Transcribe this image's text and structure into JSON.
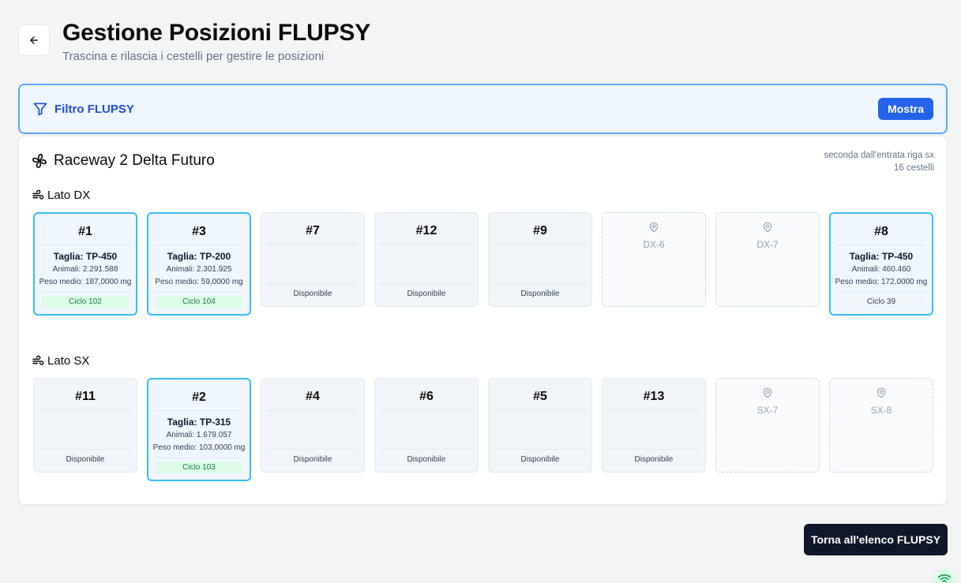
{
  "header": {
    "title": "Gestione Posizioni FLUPSY",
    "subtitle": "Trascina e rilascia i cestelli per gestire le posizioni"
  },
  "filter": {
    "label": "Filtro FLUPSY",
    "button_label": "Mostra"
  },
  "raceway": {
    "name": "Raceway 2 Delta Futuro",
    "location": "seconda dall'entrata riga sx",
    "count": "16 cestelli",
    "sides": [
      {
        "label": "Lato DX",
        "slots": [
          {
            "type": "active",
            "number": "#1",
            "taglia": "Taglia: TP-450",
            "animali": "Animali: 2.291.588",
            "peso": "Peso medio: 187,0000 mg",
            "ciclo": "Ciclo 102",
            "ciclo_style": "green"
          },
          {
            "type": "active",
            "number": "#3",
            "taglia": "Taglia: TP-200",
            "animali": "Animali: 2.301.925",
            "peso": "Peso medio: 59,0000 mg",
            "ciclo": "Ciclo 104",
            "ciclo_style": "green"
          },
          {
            "type": "available",
            "number": "#7",
            "status": "Disponibile"
          },
          {
            "type": "available",
            "number": "#12",
            "status": "Disponibile"
          },
          {
            "type": "available",
            "number": "#9",
            "status": "Disponibile"
          },
          {
            "type": "empty",
            "position": "DX-6"
          },
          {
            "type": "empty",
            "position": "DX-7"
          },
          {
            "type": "active",
            "number": "#8",
            "taglia": "Taglia: TP-450",
            "animali": "Animali: 460.460",
            "peso": "Peso medio: 172,0000 mg",
            "ciclo": "Ciclo 39",
            "ciclo_style": "gray"
          }
        ]
      },
      {
        "label": "Lato SX",
        "slots": [
          {
            "type": "available",
            "number": "#11",
            "status": "Disponibile"
          },
          {
            "type": "active",
            "number": "#2",
            "taglia": "Taglia: TP-315",
            "animali": "Animali: 1.679.057",
            "peso": "Peso medio: 103,0000 mg",
            "ciclo": "Ciclo 103",
            "ciclo_style": "green"
          },
          {
            "type": "available",
            "number": "#4",
            "status": "Disponibile"
          },
          {
            "type": "available",
            "number": "#6",
            "status": "Disponibile"
          },
          {
            "type": "available",
            "number": "#5",
            "status": "Disponibile"
          },
          {
            "type": "available",
            "number": "#13",
            "status": "Disponibile"
          },
          {
            "type": "empty",
            "position": "SX-7"
          },
          {
            "type": "empty",
            "position": "SX-8"
          }
        ]
      }
    ]
  },
  "footer": {
    "back_button_label": "Torna all'elenco FLUPSY"
  },
  "icons": {
    "back": "arrow-left-icon",
    "filter": "filter-icon",
    "raceway": "fan-icon",
    "side": "wind-icon",
    "empty_slot": "map-pin-icon",
    "status": "wifi-icon"
  },
  "colors": {
    "accent": "#2563eb",
    "active_border": "#38bdf8",
    "ciclo_green_bg": "#dcfce7",
    "dark_button": "#0f172a"
  }
}
